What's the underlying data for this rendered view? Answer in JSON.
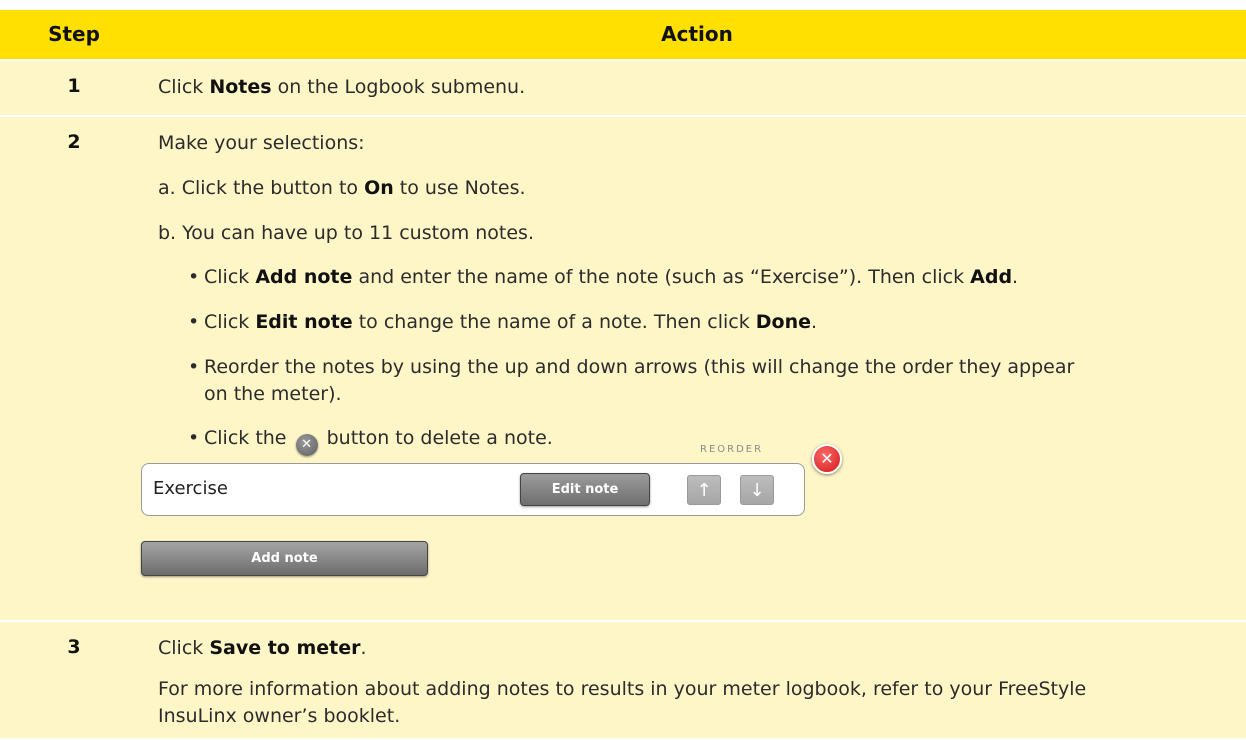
{
  "header": {
    "step_label": "Step",
    "action_label": "Action"
  },
  "rows": [
    {
      "step": "1",
      "lines": [
        {
          "pre": "Click ",
          "bold": "Notes",
          "post": " on the Logbook submenu."
        }
      ]
    },
    {
      "step": "2",
      "intro": "Make your selections:",
      "line_a": {
        "pre": "a. Click the button to ",
        "bold": "On",
        "post": " to use Notes."
      },
      "line_b": "b. You can have up to 11 custom notes.",
      "bullets": [
        {
          "pre": "Click ",
          "bold1": "Add note",
          "mid": " and enter the name of the note (such as “Exercise”). Then click ",
          "bold2": "Add",
          "post": "."
        },
        {
          "pre": "Click ",
          "bold1": "Edit note",
          "mid": " to change the name of a note. Then click ",
          "bold2": "Done",
          "post": "."
        },
        {
          "line1": "Reorder the notes by using the up and down arrows (this will change the order they appear",
          "line2": "on the meter)."
        },
        {
          "pre": "Click the ",
          "post": " button to delete a note."
        }
      ],
      "widget": {
        "reorder_label": "REORDER",
        "note_name": "Exercise",
        "edit_button": "Edit note",
        "up_icon": "arrow-up-icon",
        "down_icon": "arrow-down-icon",
        "add_button": "Add note"
      }
    },
    {
      "step": "3",
      "line1": {
        "pre": "Click ",
        "bold": "Save to meter",
        "post": "."
      },
      "line2": "For more information about adding notes to results in your meter logbook, refer to your FreeStyle",
      "line3": "InsuLinx owner’s booklet."
    }
  ],
  "colors": {
    "header": "#ffe000",
    "row": "#fff6c8",
    "delete": "#d01818"
  }
}
